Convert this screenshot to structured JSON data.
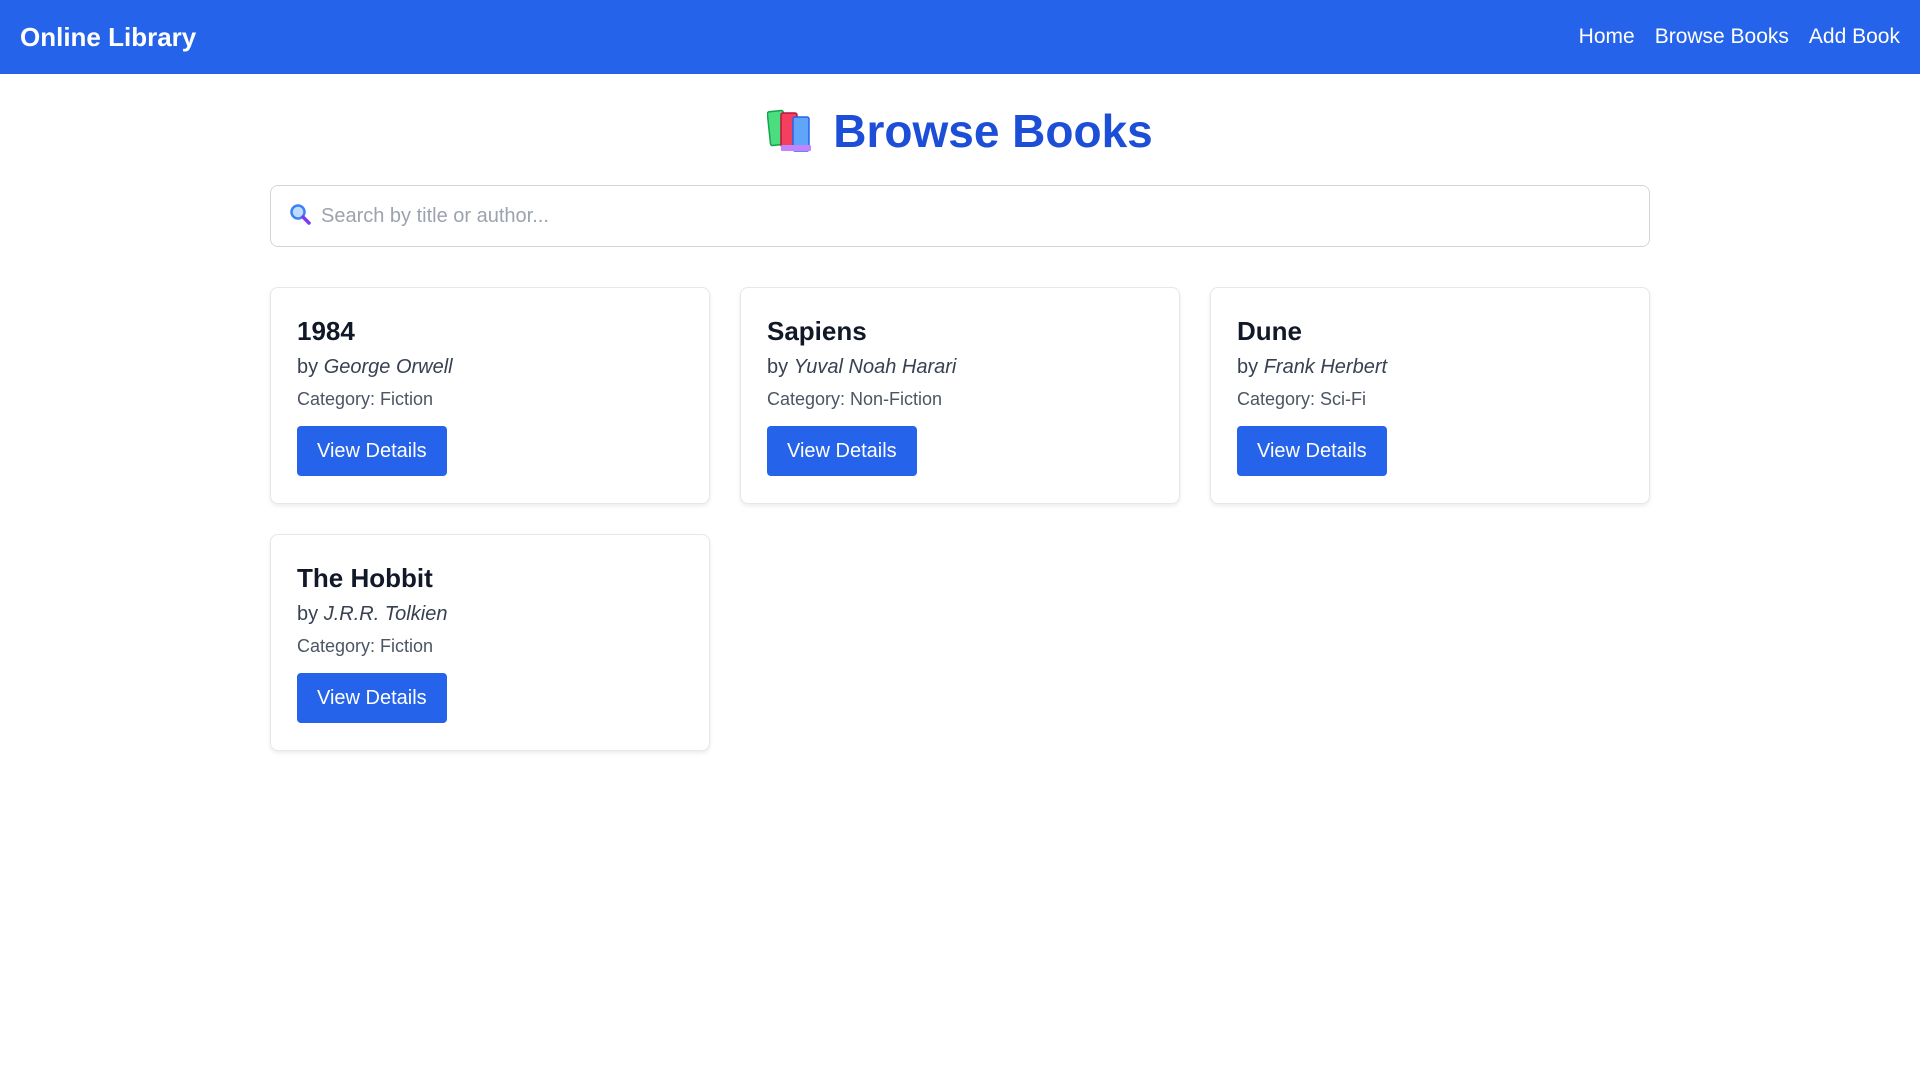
{
  "header": {
    "brand": "Online Library",
    "nav": [
      {
        "label": "Home"
      },
      {
        "label": "Browse Books"
      },
      {
        "label": "Add Book"
      }
    ],
    "background_color": "#2563eb"
  },
  "page": {
    "title": "Browse Books",
    "title_icon": "books-icon",
    "title_color": "#1d4ed8"
  },
  "search": {
    "icon": "search-icon",
    "placeholder": "Search by title or author...",
    "value": ""
  },
  "books": [
    {
      "title": "1984",
      "by": "by",
      "author": "George Orwell",
      "category": "Category: Fiction",
      "button": "View Details"
    },
    {
      "title": "Sapiens",
      "by": "by",
      "author": "Yuval Noah Harari",
      "category": "Category: Non-Fiction",
      "button": "View Details"
    },
    {
      "title": "Dune",
      "by": "by",
      "author": "Frank Herbert",
      "category": "Category: Sci-Fi",
      "button": "View Details"
    },
    {
      "title": "The Hobbit",
      "by": "by",
      "author": "J.R.R. Tolkien",
      "category": "Category: Fiction",
      "button": "View Details"
    }
  ],
  "accent_color": "#2563eb"
}
